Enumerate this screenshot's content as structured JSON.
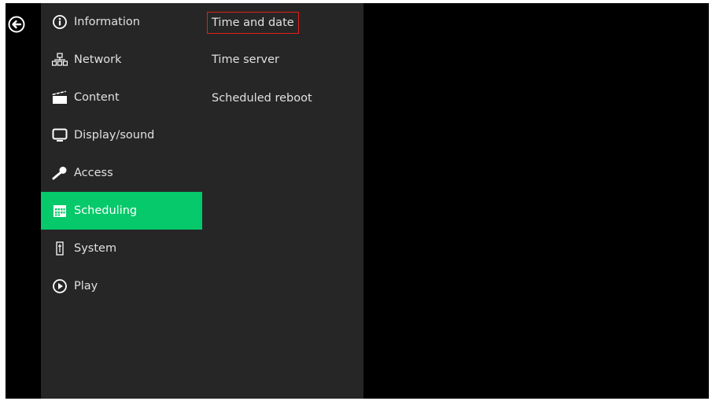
{
  "back": {
    "icon": "back-arrow-icon"
  },
  "menu": {
    "items": [
      {
        "label": "Information",
        "icon": "info-icon"
      },
      {
        "label": "Network",
        "icon": "network-icon"
      },
      {
        "label": "Content",
        "icon": "clapperboard-icon"
      },
      {
        "label": "Display/sound",
        "icon": "monitor-icon"
      },
      {
        "label": "Access",
        "icon": "key-icon"
      },
      {
        "label": "Scheduling",
        "icon": "calendar-icon"
      },
      {
        "label": "System",
        "icon": "system-icon"
      },
      {
        "label": "Play",
        "icon": "play-icon"
      }
    ],
    "active_index": 5
  },
  "submenu": {
    "items": [
      {
        "label": "Time and date"
      },
      {
        "label": "Time server"
      },
      {
        "label": "Scheduled reboot"
      }
    ],
    "focused_index": 0
  },
  "colors": {
    "panel": "#262626",
    "active": "#05c96a",
    "focus_outline": "#e0201a",
    "background": "#000000"
  }
}
